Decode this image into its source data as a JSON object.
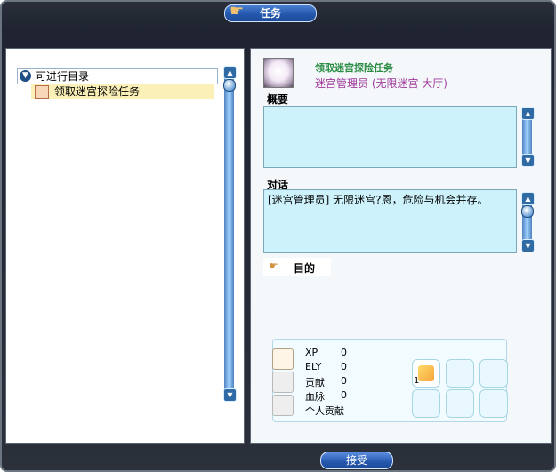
{
  "window": {
    "title": "任务"
  },
  "left_panel": {
    "tree": [
      {
        "label": "可进行目录",
        "expanded": true,
        "icon": "chevron-down-icon"
      },
      {
        "label": "领取迷宫探险任务",
        "selected": true,
        "icon": "scroll-icon"
      }
    ]
  },
  "quest": {
    "title": "领取迷宫探险任务",
    "npc": "迷宫管理员 (无限迷宫 大厅)",
    "summary_label": "概要",
    "summary_text": "",
    "dialog_label": "对话",
    "dialog_text": "[迷宫管理员] 无限迷宫?恩，危险与机会并存。",
    "goal_label": "目的"
  },
  "rewards": {
    "stats": [
      {
        "label": "XP",
        "value": "0"
      },
      {
        "label": "ELY",
        "value": "0"
      },
      {
        "label": "贡献",
        "value": "0"
      },
      {
        "label": "血脉",
        "value": "0"
      },
      {
        "label": "个人贡献",
        "value": ""
      }
    ],
    "item_count": "1"
  },
  "buttons": {
    "accept": "接受"
  },
  "colors": {
    "frame": "#2a2f3a",
    "tab_blue": "#2458ad",
    "title_green": "#2a8c42",
    "npc_purple": "#a03a9d",
    "textbox": "#cdf2fb"
  }
}
